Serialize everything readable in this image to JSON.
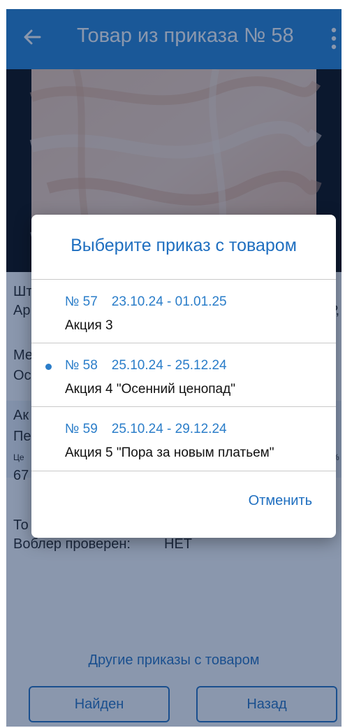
{
  "appbar": {
    "title": "Товар из приказа № 58",
    "back_icon": "arrow-back-icon",
    "more_icon": "more-vert-icon",
    "color": "#1f80d4"
  },
  "details": {
    "line1": "Шт",
    "line2": "Ар",
    "line2_right": "Р,",
    "line3": "Ме",
    "line4": "Ос",
    "line5": "Ак",
    "line6": "Пе",
    "line7": "Це",
    "line7_right": "%",
    "line8": "67",
    "line9": "То",
    "wobbler_label": "Воблер проверен:",
    "wobbler_value": "НЕТ"
  },
  "footer": {
    "other_orders_link": "Другие приказы с товаром",
    "found_button": "Найден",
    "back_button": "Назад"
  },
  "dialog": {
    "title": "Выберите приказ с товаром",
    "orders": [
      {
        "number": "№ 57",
        "dates": "23.10.24 - 01.01.25",
        "name": "Акция 3",
        "selected": false
      },
      {
        "number": "№ 58",
        "dates": "25.10.24 - 25.12.24",
        "name": "Акция 4 \"Осенний ценопад\"",
        "selected": true
      },
      {
        "number": "№ 59",
        "dates": "25.10.24 - 29.12.24",
        "name": "Акция 5 \"Пора за новым платьем\"",
        "selected": false
      }
    ],
    "cancel_label": "Отменить",
    "accent": "#1f6fc0"
  }
}
